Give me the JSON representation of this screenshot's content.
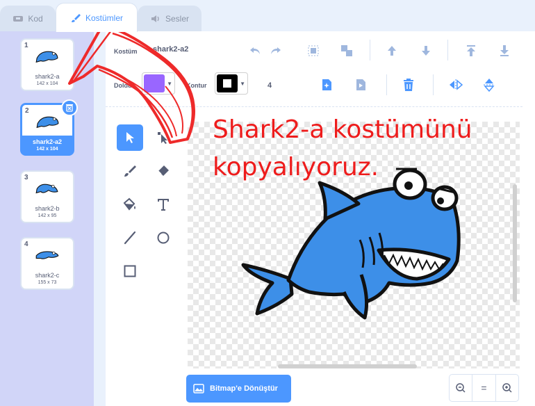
{
  "tabs": [
    {
      "label": "Kod",
      "icon": "code-icon"
    },
    {
      "label": "Kostümler",
      "icon": "brush-icon"
    },
    {
      "label": "Sesler",
      "icon": "speaker-icon"
    }
  ],
  "costumes": [
    {
      "num": "1",
      "name": "shark2-a",
      "size": "142 x 104"
    },
    {
      "num": "2",
      "name": "shark2-a2",
      "size": "142 x 104"
    },
    {
      "num": "3",
      "name": "shark2-b",
      "size": "142 x 95"
    },
    {
      "num": "4",
      "name": "shark2-c",
      "size": "155 x 73"
    }
  ],
  "editor": {
    "costume_label": "Kostüm",
    "costume_name": "shark2-a2",
    "fill_label": "Doldur",
    "outline_label": "Kontur",
    "fill_color": "#9966ff",
    "outline_color": "#000000",
    "outline_width": "4"
  },
  "bitmap_button": "Bitmap'e Dönüştür",
  "zoom": {
    "out": "−",
    "reset": "=",
    "in": "+"
  },
  "annotation": {
    "line1": "Shark2-a kostümünü",
    "line2": "kopyalıyoruz."
  },
  "colors": {
    "accent": "#4c97ff",
    "annotation": "#ee1c1c",
    "shark": "#3d8fe8"
  }
}
